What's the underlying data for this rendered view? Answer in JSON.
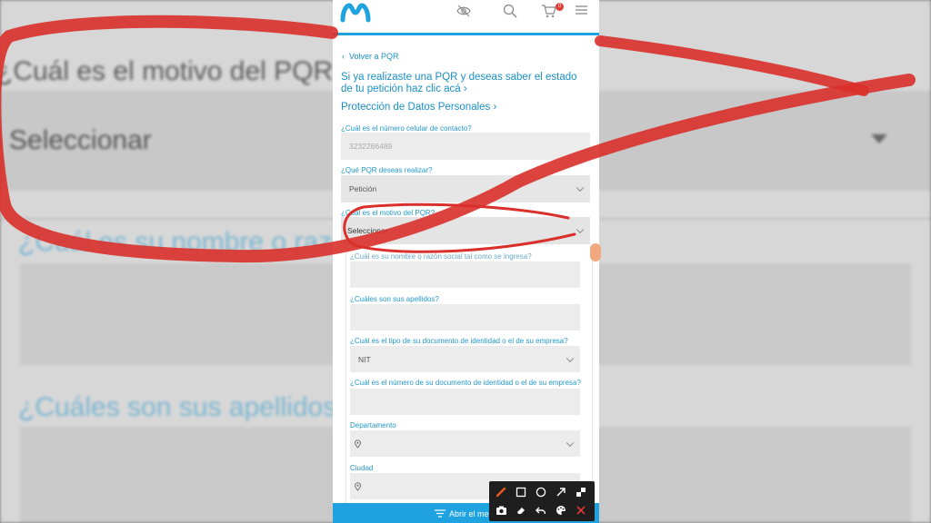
{
  "background": {
    "question_motivo": "¿Cuál es el motivo del PQR?",
    "select_placeholder": "Seleccionar",
    "question_nombre": "¿Cuál es su nombre o razón social?",
    "question_apellidos": "¿Cuáles son sus apellidos?"
  },
  "header": {
    "logo": "movistar-m-logo",
    "icons": [
      "eye-off-icon",
      "search-icon",
      "cart-icon",
      "menu-icon"
    ],
    "cart_badge": "0",
    "accent_color": "#1fa3e0"
  },
  "nav": {
    "back_label": "Volver a PQR",
    "status_link": "Si ya realizaste una PQR y deseas saber el estado de tu petición haz clic acá",
    "section_title": "Protección de Datos Personales"
  },
  "form": {
    "phone_label": "¿Cuál es el número celular de contacto?",
    "phone_value": "3232266489",
    "pqr_type_label": "¿Qué PQR deseas realizar?",
    "pqr_type_value": "Petición",
    "motivo_label": "¿Cuál es el motivo del PQR?",
    "motivo_value": "Seleccionar",
    "nombre_label": "¿Cuál es su nombre o razón social tal como se ingresa?",
    "apellidos_label": "¿Cuáles son sus apellidos?",
    "doc_type_label": "¿Cuál es el tipo de su documento de identidad o el de su empresa?",
    "doc_type_value": "NIT",
    "doc_number_label": "¿Cuál es el número de su documento de identidad o el de su empresa?",
    "departamento_label": "Departamento",
    "ciudad_label": "Ciudad"
  },
  "footer": {
    "label": "Abrir el me"
  },
  "annotation_toolbar": {
    "tools": [
      "pen-icon",
      "rectangle-icon",
      "circle-icon",
      "arrow-icon",
      "checker-icon",
      "camera-icon",
      "eraser-icon",
      "undo-icon",
      "palette-icon",
      "close-icon"
    ],
    "pen_color": "#e8571e",
    "close_color": "#e53935"
  },
  "annotation_color": "#d9302b"
}
